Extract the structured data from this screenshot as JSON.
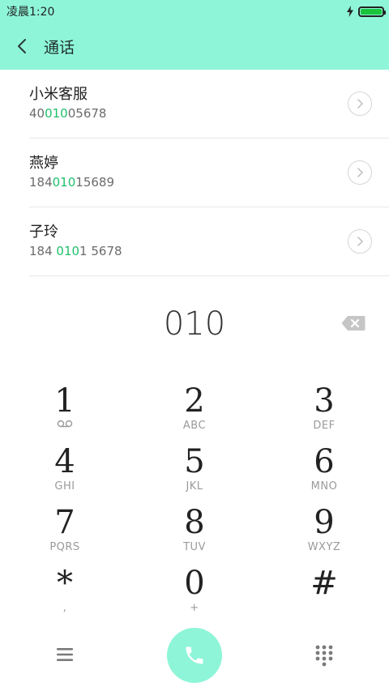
{
  "status": {
    "time": "凌晨1:20",
    "battery": 1.0
  },
  "header": {
    "title": "通话"
  },
  "results": [
    {
      "name": "小米客服",
      "num_pre": "40",
      "num_hl": "010",
      "num_post": "05678"
    },
    {
      "name": "燕婷",
      "num_pre": "184",
      "num_hl": "010",
      "num_post": "15689"
    },
    {
      "name": "子玲",
      "num_pre": "184 ",
      "num_hl": "010",
      "num_post": "1 5678"
    }
  ],
  "dial": {
    "input": "010"
  },
  "keypad": [
    {
      "digit": "1",
      "sub": ""
    },
    {
      "digit": "2",
      "sub": "ABC"
    },
    {
      "digit": "3",
      "sub": "DEF"
    },
    {
      "digit": "4",
      "sub": "GHI"
    },
    {
      "digit": "5",
      "sub": "JKL"
    },
    {
      "digit": "6",
      "sub": "MNO"
    },
    {
      "digit": "7",
      "sub": "PQRS"
    },
    {
      "digit": "8",
      "sub": "TUV"
    },
    {
      "digit": "9",
      "sub": "WXYZ"
    },
    {
      "digit": "*",
      "sub": ","
    },
    {
      "digit": "0",
      "sub": "+"
    },
    {
      "digit": "#",
      "sub": ""
    }
  ],
  "icons": {
    "back": "chevron-left-icon",
    "voicemail": "voicemail-icon",
    "delete": "backspace-icon",
    "menu": "menu-icon",
    "call": "phone-icon",
    "dialpad": "dialpad-icon"
  },
  "colors": {
    "accent": "#8ef5d8",
    "highlight": "#1fc06b"
  }
}
